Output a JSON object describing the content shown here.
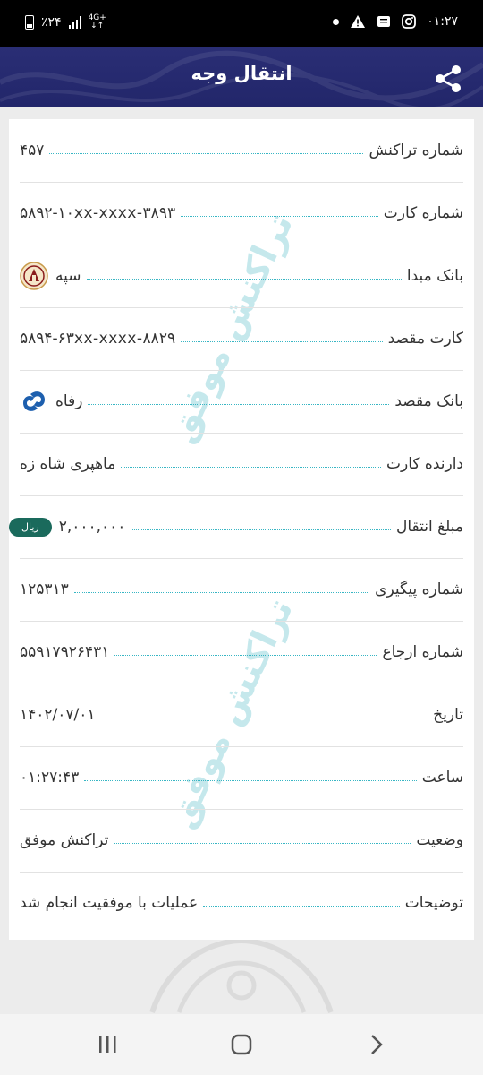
{
  "status_bar": {
    "time": "۰۱:۲۷",
    "battery": "٪۲۴",
    "network": "4G+"
  },
  "header": {
    "title": "انتقال وجه",
    "share_icon": "share-icon"
  },
  "watermark_text": "تراکنش موفق",
  "rows": [
    {
      "label": "شماره تراکنش",
      "value": "۴۵۷"
    },
    {
      "label": "شماره کارت",
      "value": "۵۸۹۲-۱۰xx-xxxx-۳۸۹۳"
    },
    {
      "label": "بانک مبدا",
      "value": "سپه",
      "icon": "bank-sepah-logo-icon"
    },
    {
      "label": "کارت مقصد",
      "value": "۵۸۹۴-۶۳xx-xxxx-۸۸۲۹"
    },
    {
      "label": "بانک مقصد",
      "value": "رفاه",
      "icon": "bank-refah-logo-icon"
    },
    {
      "label": "دارنده کارت",
      "value": "ماهپری شاه زه"
    },
    {
      "label": "مبلغ انتقال",
      "value": "۲,۰۰۰,۰۰۰",
      "badge": "ریال"
    },
    {
      "label": "شماره پیگیری",
      "value": "۱۲۵۳۱۳"
    },
    {
      "label": "شماره ارجاع",
      "value": "۵۵۹۱۷۹۲۶۴۳۱"
    },
    {
      "label": "تاریخ",
      "value": "۱۴۰۲/۰۷/۰۱"
    },
    {
      "label": "ساعت",
      "value": "۰۱:۲۷:۴۳"
    },
    {
      "label": "وضعیت",
      "value": "تراکنش موفق"
    },
    {
      "label": "توضیحات",
      "value": "عملیات با موفقیت انجام شد"
    }
  ],
  "colors": {
    "header": "#22266a",
    "dots": "#37b6c4",
    "badge": "#1a6a5c",
    "watermark": "#b7e3e8"
  }
}
